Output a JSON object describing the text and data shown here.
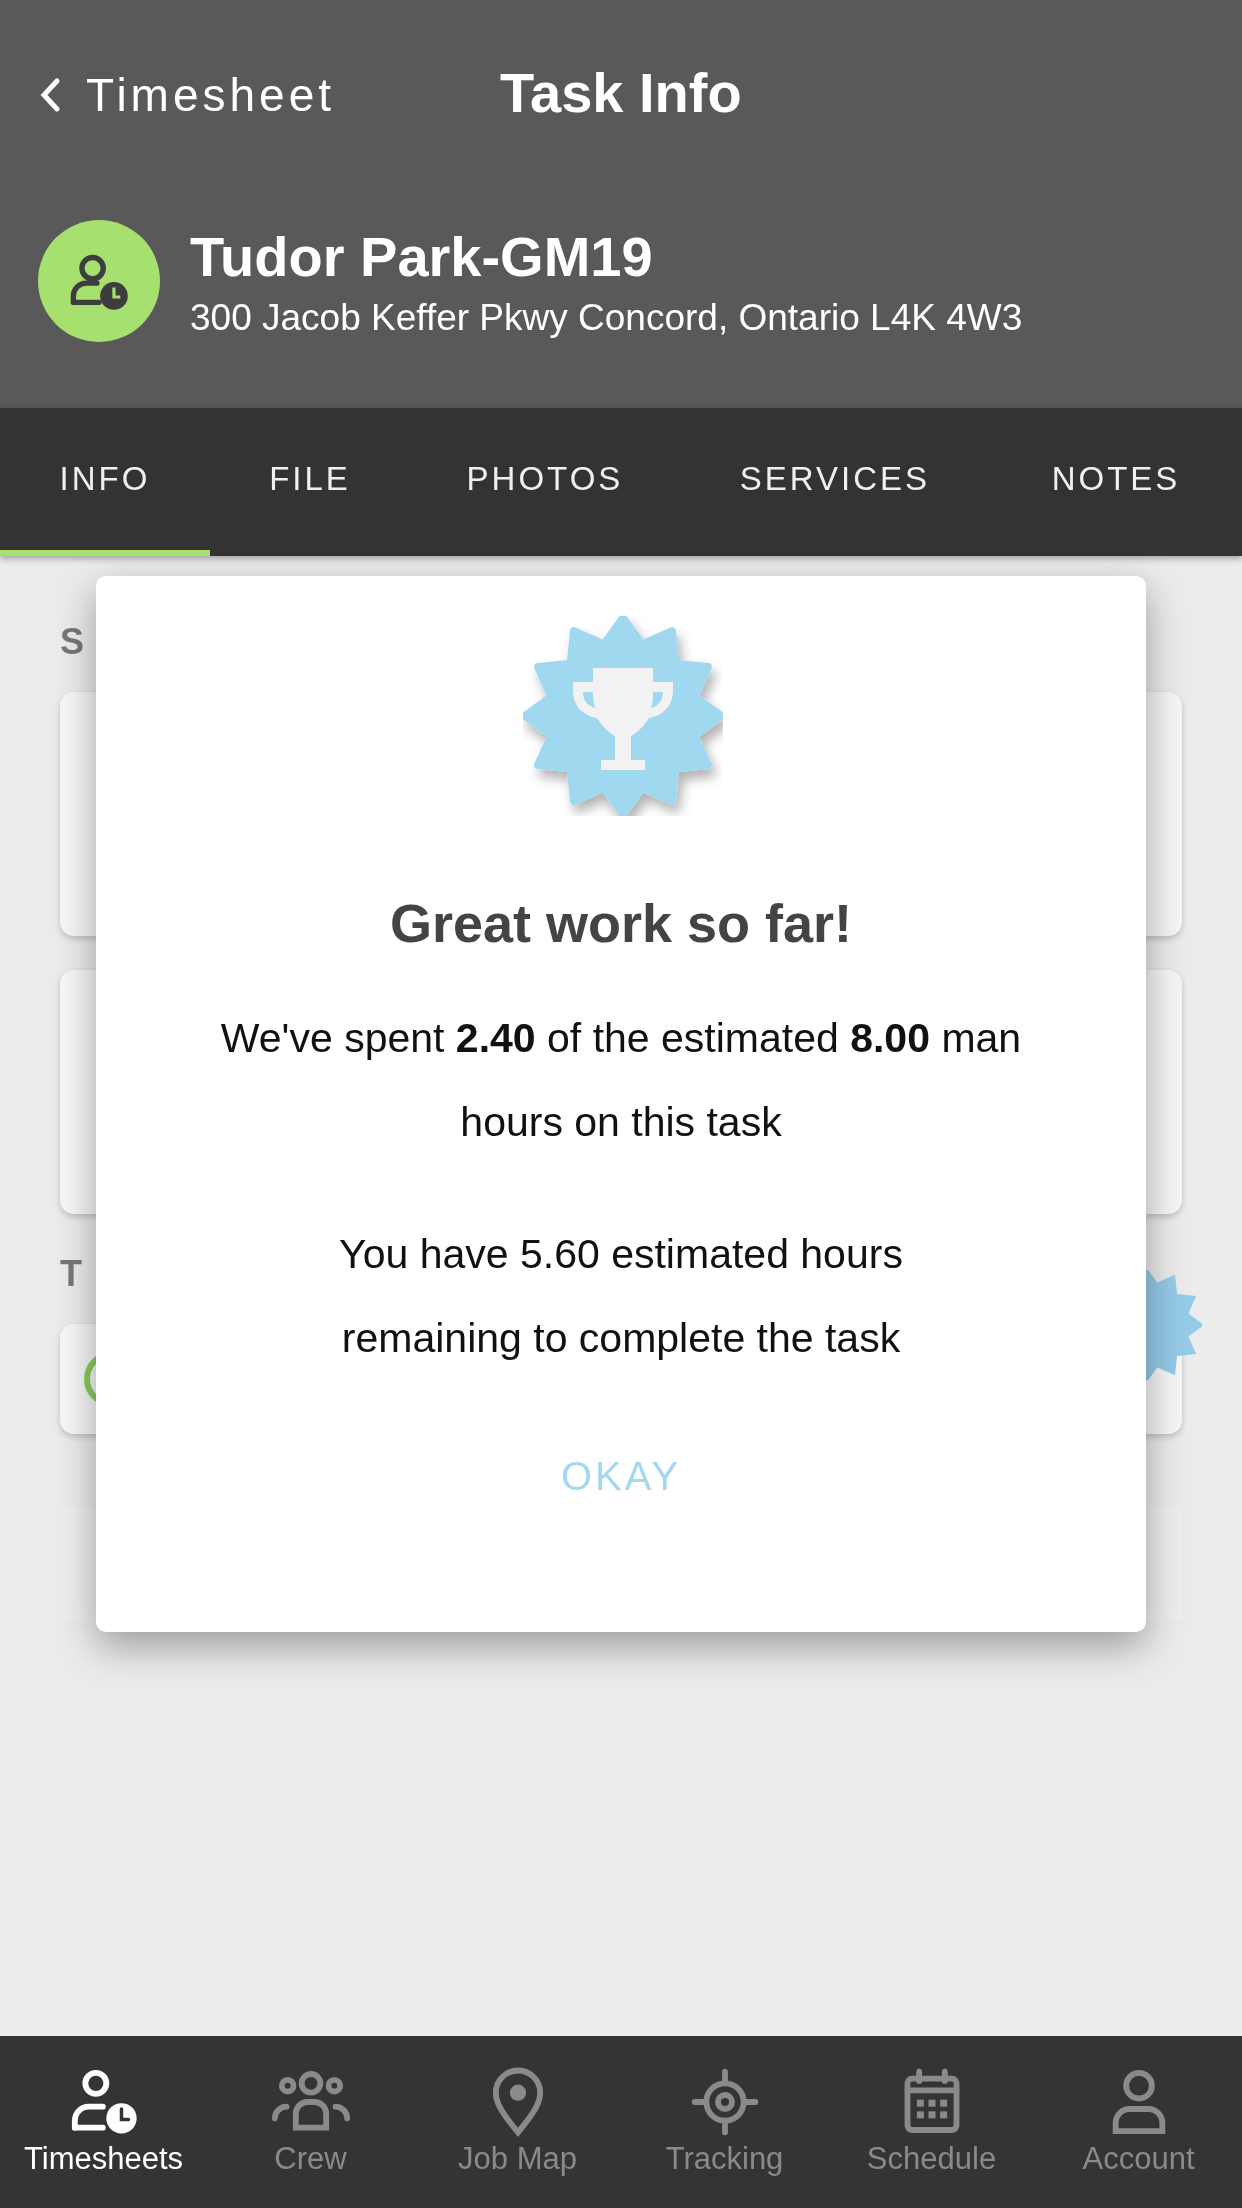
{
  "nav": {
    "back_label": "Timesheet",
    "title": "Task Info"
  },
  "job": {
    "name": "Tudor Park-GM19",
    "address": "300 Jacob Keffer Pkwy Concord, Ontario L4K 4W3"
  },
  "tabs": [
    {
      "label": "INFO",
      "selected": true
    },
    {
      "label": "FILE",
      "selected": false
    },
    {
      "label": "PHOTOS",
      "selected": false
    },
    {
      "label": "SERVICES",
      "selected": false
    },
    {
      "label": "NOTES",
      "selected": false
    }
  ],
  "sections": [
    {
      "heading": "S",
      "cards": [
        {
          "kind": "plain"
        },
        {
          "kind": "plain"
        }
      ]
    },
    {
      "heading": "T",
      "cards": [
        {
          "kind": "status"
        },
        {
          "kind": "flat"
        }
      ]
    }
  ],
  "dialog": {
    "title": "Great work so far!",
    "messages": [
      "We've spent **2.40** of the estimated **8.00** man hours on this task",
      "You have 5.60 estimated hours remaining to complete the task"
    ],
    "button": "OKAY"
  },
  "bottom_nav": [
    {
      "label": "Timesheets",
      "kind": "timesheet",
      "selected": true
    },
    {
      "label": "Crew",
      "kind": "crew",
      "selected": false
    },
    {
      "label": "Job Map",
      "kind": "pin",
      "selected": false
    },
    {
      "label": "Tracking",
      "kind": "target",
      "selected": false
    },
    {
      "label": "Schedule",
      "kind": "calendar",
      "selected": false
    },
    {
      "label": "Account",
      "kind": "person",
      "selected": false
    }
  ]
}
